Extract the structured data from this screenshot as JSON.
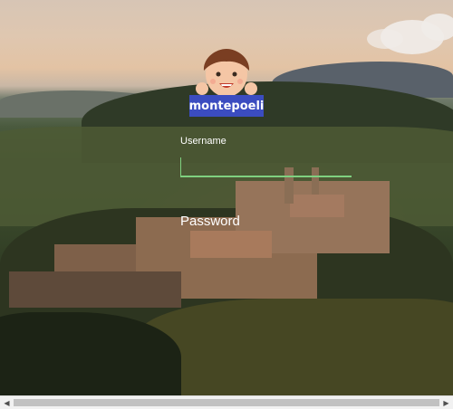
{
  "app": {
    "brand_label": "montepoeli"
  },
  "login": {
    "username_label": "Username",
    "username_value": "",
    "password_label": "Password",
    "password_value": ""
  },
  "scrollbar": {
    "left_arrow": "◀",
    "right_arrow": "▶"
  },
  "colors": {
    "brand_bg": "#3b4cc0",
    "input_underline": "#7fd07f",
    "label_text": "#ffffff"
  },
  "icons": {
    "avatar": "child-avatar-icon"
  }
}
